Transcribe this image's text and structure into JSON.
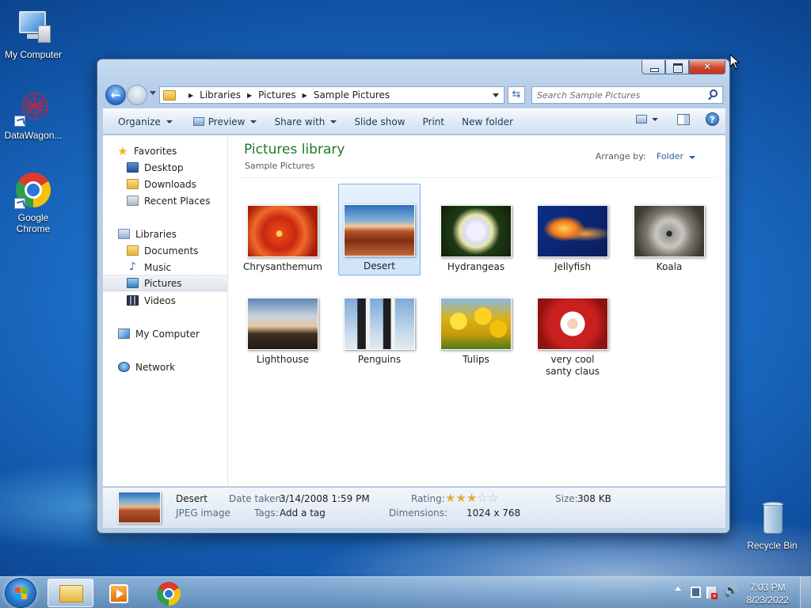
{
  "desktop": {
    "icons": [
      {
        "label": "My Computer"
      },
      {
        "label": "DataWagon..."
      },
      {
        "label": "Google Chrome"
      },
      {
        "label": "Recycle Bin"
      }
    ]
  },
  "window": {
    "breadcrumb": [
      "Libraries",
      "Pictures",
      "Sample Pictures"
    ],
    "search_placeholder": "Search Sample Pictures",
    "toolbar": {
      "organize": "Organize",
      "preview": "Preview",
      "share_with": "Share with",
      "slide_show": "Slide show",
      "print": "Print",
      "new_folder": "New folder"
    },
    "nav": {
      "favorites": "Favorites",
      "desktop": "Desktop",
      "downloads": "Downloads",
      "recent_places": "Recent Places",
      "libraries": "Libraries",
      "documents": "Documents",
      "music": "Music",
      "pictures": "Pictures",
      "videos": "Videos",
      "my_computer": "My Computer",
      "network": "Network"
    },
    "library": {
      "title": "Pictures library",
      "subtitle": "Sample Pictures",
      "arrange_label": "Arrange by:",
      "arrange_value": "Folder"
    },
    "files": [
      {
        "name": "Chrysanthemum"
      },
      {
        "name": "Desert",
        "selected": true
      },
      {
        "name": "Hydrangeas"
      },
      {
        "name": "Jellyfish"
      },
      {
        "name": "Koala"
      },
      {
        "name": "Lighthouse"
      },
      {
        "name": "Penguins"
      },
      {
        "name": "Tulips"
      },
      {
        "name": "very cool santy claus"
      }
    ],
    "details": {
      "name": "Desert",
      "type": "JPEG image",
      "date_taken_label": "Date taken:",
      "date_taken": "3/14/2008 1:59 PM",
      "tags_label": "Tags:",
      "tags": "Add a tag",
      "rating_label": "Rating:",
      "rating": 3,
      "rating_max": 5,
      "dimensions_label": "Dimensions:",
      "dimensions": "1024 x 768",
      "size_label": "Size:",
      "size": "308 KB"
    }
  },
  "taskbar": {
    "time": "7:03 PM",
    "date": "8/23/2022"
  },
  "colors": {
    "library_title": "#1d7a27",
    "link_blue": "#2b5fa5",
    "selection": "#cde3f9"
  }
}
